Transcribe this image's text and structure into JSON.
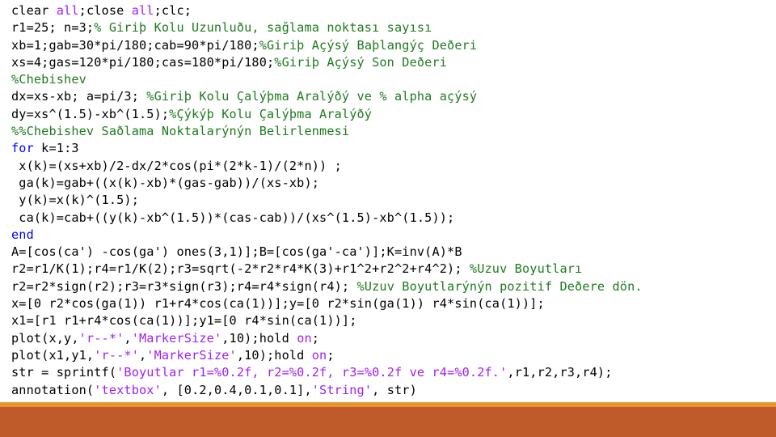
{
  "slide": {
    "background_color": "#ffffff",
    "accent_stripe_color": "#e8962b",
    "footer_band_color": "#bf5a2b"
  },
  "syntax_colors": {
    "plain": "#000000",
    "keyword": "#0000ff",
    "string": "#a020f0",
    "comment": "#1e7a1e"
  },
  "code": {
    "language": "MATLAB",
    "lines": [
      [
        {
          "t": "clear ",
          "c": "plain"
        },
        {
          "t": "all",
          "c": "string"
        },
        {
          "t": ";close ",
          "c": "plain"
        },
        {
          "t": "all",
          "c": "string"
        },
        {
          "t": ";clc;",
          "c": "plain"
        }
      ],
      [
        {
          "t": "r1=25; n=3;",
          "c": "plain"
        },
        {
          "t": "% Giriþ Kolu Uzunluðu, sağlama noktası sayısı",
          "c": "comment"
        }
      ],
      [
        {
          "t": "xb=1;gab=30*pi/180;cab=90*pi/180;",
          "c": "plain"
        },
        {
          "t": "%Giriþ Açýsý Baþlangýç Deðeri",
          "c": "comment"
        }
      ],
      [
        {
          "t": "xs=4;gas=120*pi/180;cas=180*pi/180;",
          "c": "plain"
        },
        {
          "t": "%Giriþ Açýsý Son Deðeri",
          "c": "comment"
        }
      ],
      [
        {
          "t": "%Chebishev",
          "c": "comment"
        }
      ],
      [
        {
          "t": "dx=xs-xb; a=pi/3; ",
          "c": "plain"
        },
        {
          "t": "%Giriþ Kolu Çalýþma Aralýðý ve % alpha açýsý",
          "c": "comment"
        }
      ],
      [
        {
          "t": "dy=xs^(1.5)-xb^(1.5);",
          "c": "plain"
        },
        {
          "t": "%Çýkýþ Kolu Çalýþma Aralýðý",
          "c": "comment"
        }
      ],
      [
        {
          "t": "%%Chebishev Saðlama Noktalarýnýn Belirlenmesi",
          "c": "comment"
        }
      ],
      [
        {
          "t": "for",
          "c": "keyword"
        },
        {
          "t": " k=1:3",
          "c": "plain"
        }
      ],
      [
        {
          "t": " x(k)=(xs+xb)/2-dx/2*cos(pi*(2*k-1)/(2*n)) ;",
          "c": "plain"
        }
      ],
      [
        {
          "t": " ga(k)=gab+((x(k)-xb)*(gas-gab))/(xs-xb);",
          "c": "plain"
        }
      ],
      [
        {
          "t": " y(k)=x(k)^(1.5);",
          "c": "plain"
        }
      ],
      [
        {
          "t": " ca(k)=cab+((y(k)-xb^(1.5))*(cas-cab))/(xs^(1.5)-xb^(1.5));",
          "c": "plain"
        }
      ],
      [
        {
          "t": "end",
          "c": "keyword"
        }
      ],
      [
        {
          "t": "A=[cos(ca') -cos(ga') ones(3,1)];B=[cos(ga'-ca')];K=inv(A)*B",
          "c": "plain"
        }
      ],
      [
        {
          "t": "r2=r1/K(1);r4=r1/K(2);r3=sqrt(-2*r2*r4*K(3)+r1^2+r2^2+r4^2); ",
          "c": "plain"
        },
        {
          "t": "%Uzuv Boyutları",
          "c": "comment"
        }
      ],
      [
        {
          "t": "r2=r2*sign(r2);r3=r3*sign(r3);r4=r4*sign(r4); ",
          "c": "plain"
        },
        {
          "t": "%Uzuv Boyutlarýnýn pozitif Deðere dön.",
          "c": "comment"
        }
      ],
      [
        {
          "t": "x=[0 r2*cos(ga(1)) r1+r4*cos(ca(1))];y=[0 r2*sin(ga(1)) r4*sin(ca(1))];",
          "c": "plain"
        }
      ],
      [
        {
          "t": "x1=[r1 r1+r4*cos(ca(1))];y1=[0 r4*sin(ca(1))];",
          "c": "plain"
        }
      ],
      [
        {
          "t": "plot(x,y,",
          "c": "plain"
        },
        {
          "t": "'r--*'",
          "c": "string"
        },
        {
          "t": ",",
          "c": "plain"
        },
        {
          "t": "'MarkerSize'",
          "c": "string"
        },
        {
          "t": ",10);hold ",
          "c": "plain"
        },
        {
          "t": "on",
          "c": "string"
        },
        {
          "t": ";",
          "c": "plain"
        }
      ],
      [
        {
          "t": "plot(x1,y1,",
          "c": "plain"
        },
        {
          "t": "'r--*'",
          "c": "string"
        },
        {
          "t": ",",
          "c": "plain"
        },
        {
          "t": "'MarkerSize'",
          "c": "string"
        },
        {
          "t": ",10);hold ",
          "c": "plain"
        },
        {
          "t": "on",
          "c": "string"
        },
        {
          "t": ";",
          "c": "plain"
        }
      ],
      [
        {
          "t": "str = sprintf(",
          "c": "plain"
        },
        {
          "t": "'Boyutlar r1=%0.2f, r2=%0.2f, r3=%0.2f ve r4=%0.2f.'",
          "c": "string"
        },
        {
          "t": ",r1,r2,r3,r4);",
          "c": "plain"
        }
      ],
      [
        {
          "t": "annotation(",
          "c": "plain"
        },
        {
          "t": "'textbox'",
          "c": "string"
        },
        {
          "t": ", [0.2,0.4,0.1,0.1],",
          "c": "plain"
        },
        {
          "t": "'String'",
          "c": "string"
        },
        {
          "t": ", str)",
          "c": "plain"
        }
      ]
    ]
  }
}
